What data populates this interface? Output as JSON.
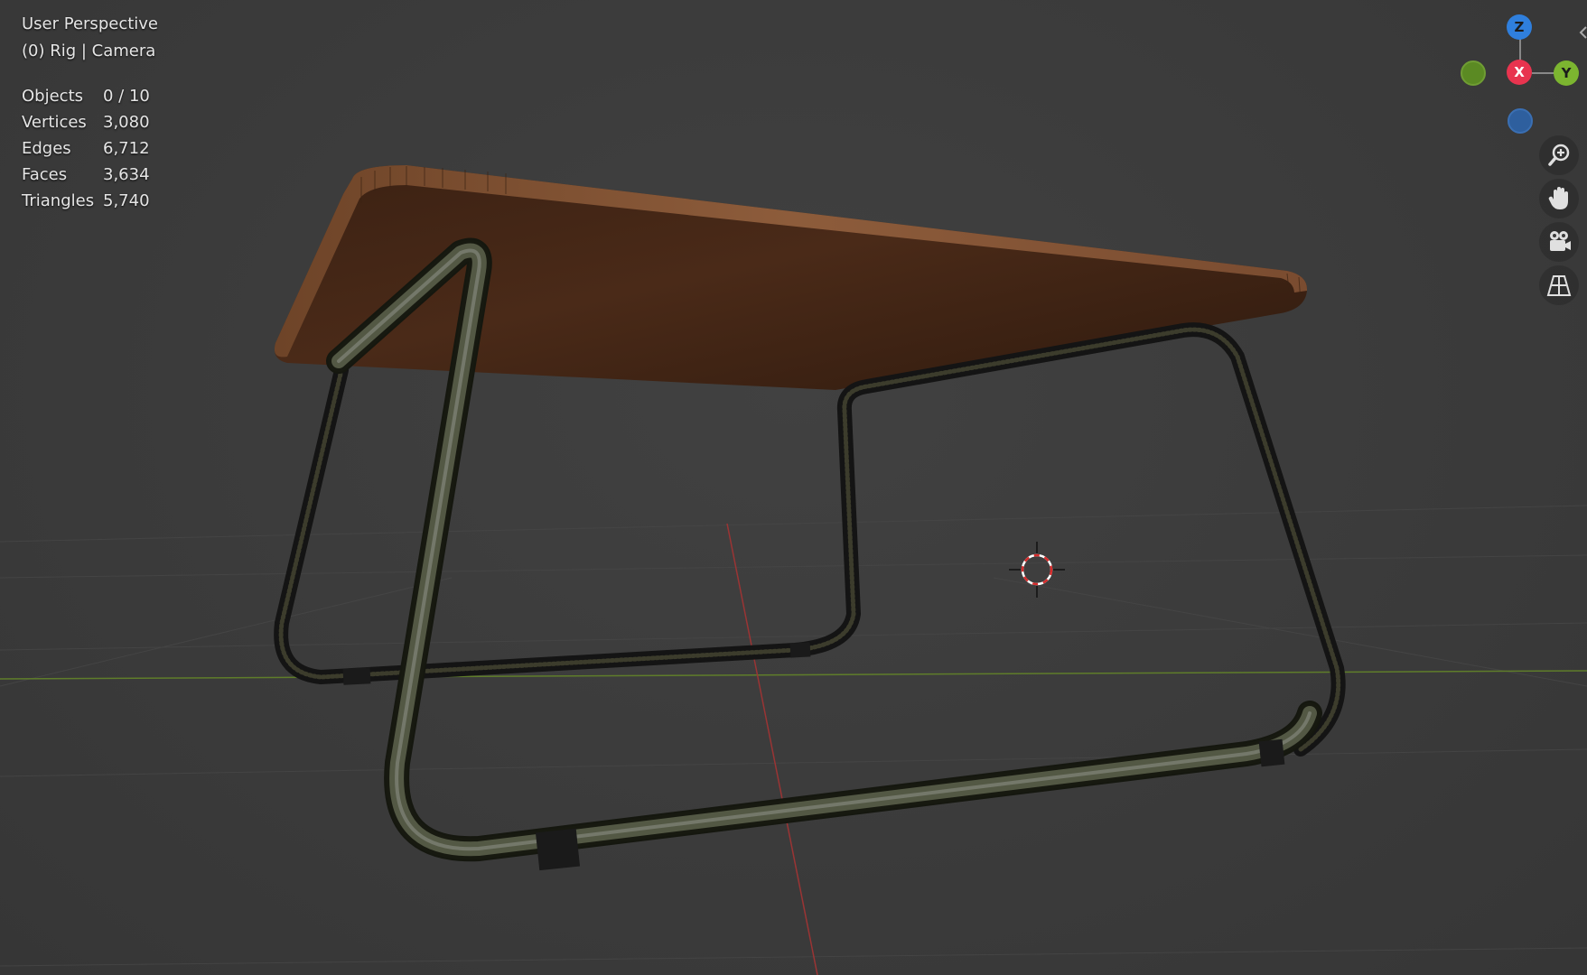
{
  "viewport": {
    "view_name": "User Perspective",
    "context": "(0) Rig | Camera"
  },
  "stats": [
    {
      "label": "Objects",
      "value": "0 / 10"
    },
    {
      "label": "Vertices",
      "value": "3,080"
    },
    {
      "label": "Edges",
      "value": "6,712"
    },
    {
      "label": "Faces",
      "value": "3,634"
    },
    {
      "label": "Triangles",
      "value": "5,740"
    }
  ],
  "gizmo": {
    "z_label": "Z",
    "x_label": "X",
    "y_label": "Y",
    "colors": {
      "z": "#2f7fdd",
      "x": "#e8344f",
      "y": "#7cb530",
      "neg_y": "#5b8a23",
      "neg_z": "#2e5f9e"
    }
  },
  "nav_buttons": [
    {
      "icon": "zoom-in-icon"
    },
    {
      "icon": "hand-pan-icon"
    },
    {
      "icon": "camera-view-icon"
    },
    {
      "icon": "perspective-grid-icon"
    }
  ],
  "theme": {
    "background": "#3a3a3a",
    "grid_line": "#4a4a4a",
    "x_axis_line": "#a33a3a",
    "y_axis_line": "#6a8a2a",
    "wood_top": "#8a5a3a",
    "wood_under": "#4a2a1a",
    "cursor_red": "#e03030"
  }
}
